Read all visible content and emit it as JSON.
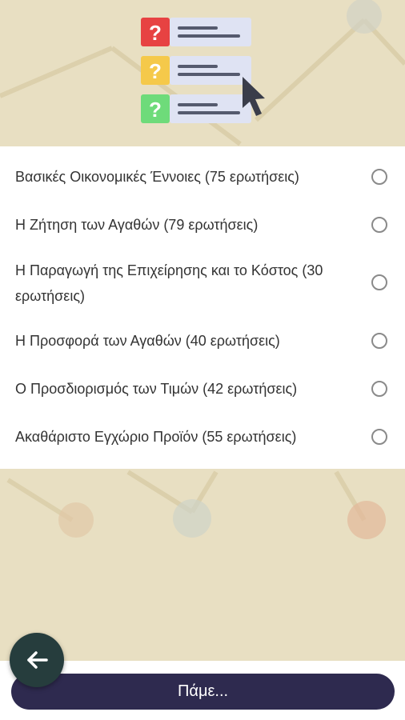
{
  "colors": {
    "background": "#e8dfc2",
    "card": "#ffffff",
    "primary_button": "#2e2a4f",
    "back_button": "#263d3d",
    "question_red": "#e74242",
    "question_yellow": "#f5c94a",
    "question_green": "#6edb7a"
  },
  "icons": {
    "hero": "quiz-questions-illustration",
    "back": "arrow-left-icon",
    "radio": "radio-unchecked-icon"
  },
  "options": [
    {
      "label": "Βασικές Οικονομικές Έννοιες (75 ερωτήσεις)",
      "selected": false
    },
    {
      "label": "Η Ζήτηση των Αγαθών (79 ερωτήσεις)",
      "selected": false
    },
    {
      "label": "Η Παραγωγή της Επιχείρησης και το Κόστος (30 ερωτήσεις)",
      "selected": false
    },
    {
      "label": "Η Προσφορά των Αγαθών (40 ερωτήσεις)",
      "selected": false
    },
    {
      "label": "Ο Προσδιορισμός των Τιμών (42 ερωτήσεις)",
      "selected": false
    },
    {
      "label": "Ακαθάριστο Εγχώριο Προϊόν (55 ερωτήσεις)",
      "selected": false
    }
  ],
  "hero": {
    "question_mark": "?"
  },
  "footer": {
    "go_label": "Πάμε..."
  }
}
